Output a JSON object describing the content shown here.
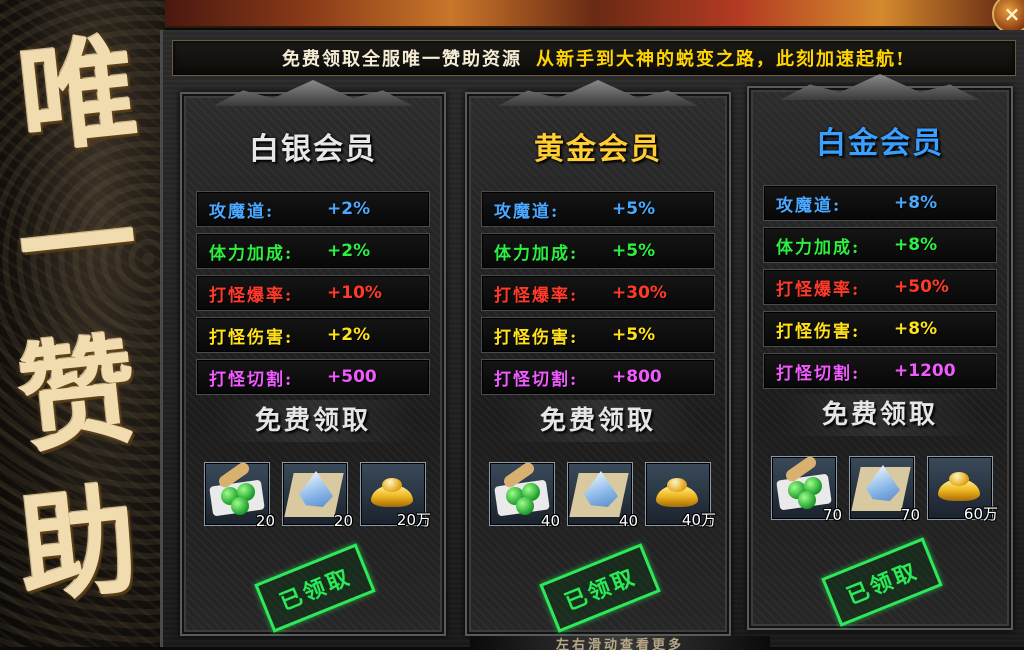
{
  "banner": {
    "chars": [
      "唯",
      "一",
      "赞",
      "助"
    ]
  },
  "slogan": {
    "part1": "免费领取全服唯一赞助资源",
    "part2": "从新手到大神的蜕变之路，此刻加速起航!"
  },
  "close_label": "×",
  "cards": [
    {
      "title": "白银会员",
      "title_color": "#e8e8e8",
      "stats": [
        {
          "name": "攻魔道:",
          "value": "+2%",
          "color": "blue"
        },
        {
          "name": "体力加成:",
          "value": "+2%",
          "color": "green"
        },
        {
          "name": "打怪爆率:",
          "value": "+10%",
          "color": "red"
        },
        {
          "name": "打怪伤害:",
          "value": "+2%",
          "color": "yellow"
        },
        {
          "name": "打怪切割:",
          "value": "+500",
          "color": "purple"
        }
      ],
      "claim_header": "免费领取",
      "rewards": [
        {
          "icon": "pills-icon",
          "count": "20"
        },
        {
          "icon": "crystal-icon",
          "count": "20"
        },
        {
          "icon": "gold-ingot-icon",
          "count": "20万"
        }
      ],
      "status": "已领取"
    },
    {
      "title": "黄金会员",
      "title_color": "#ffcc33",
      "stats": [
        {
          "name": "攻魔道:",
          "value": "+5%",
          "color": "blue"
        },
        {
          "name": "体力加成:",
          "value": "+5%",
          "color": "green"
        },
        {
          "name": "打怪爆率:",
          "value": "+30%",
          "color": "red"
        },
        {
          "name": "打怪伤害:",
          "value": "+5%",
          "color": "yellow"
        },
        {
          "name": "打怪切割:",
          "value": "+800",
          "color": "purple"
        }
      ],
      "claim_header": "免费领取",
      "rewards": [
        {
          "icon": "pills-icon",
          "count": "40"
        },
        {
          "icon": "crystal-icon",
          "count": "40"
        },
        {
          "icon": "gold-ingot-icon",
          "count": "40万"
        }
      ],
      "status": "已领取"
    },
    {
      "title": "白金会员",
      "title_color": "#3aa0ff",
      "stats": [
        {
          "name": "攻魔道:",
          "value": "+8%",
          "color": "blue"
        },
        {
          "name": "体力加成:",
          "value": "+8%",
          "color": "green"
        },
        {
          "name": "打怪爆率:",
          "value": "+50%",
          "color": "red"
        },
        {
          "name": "打怪伤害:",
          "value": "+8%",
          "color": "yellow"
        },
        {
          "name": "打怪切割:",
          "value": "+1200",
          "color": "purple"
        }
      ],
      "claim_header": "免费领取",
      "rewards": [
        {
          "icon": "pills-icon",
          "count": "70"
        },
        {
          "icon": "crystal-icon",
          "count": "70"
        },
        {
          "icon": "gold-ingot-icon",
          "count": "60万"
        }
      ],
      "status": "已领取"
    }
  ],
  "bottom_text": "左右滑动查看更多"
}
